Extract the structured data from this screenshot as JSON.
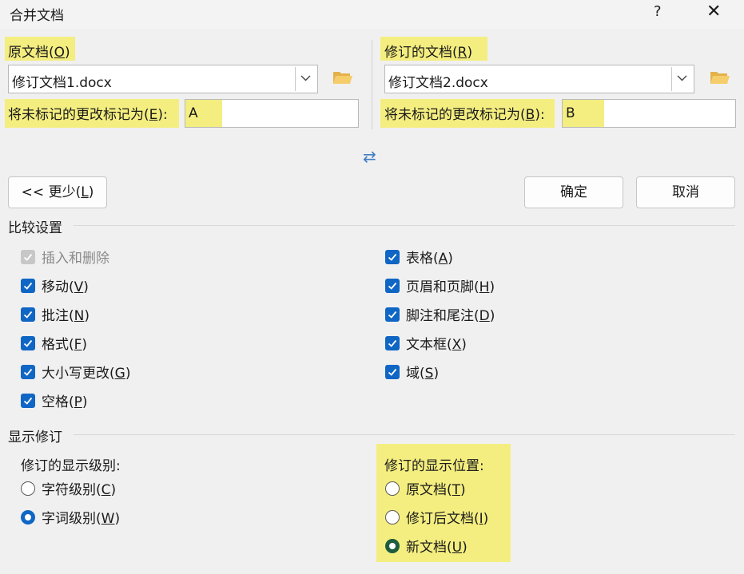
{
  "window": {
    "title": "合并文档",
    "help_glyph": "?",
    "close_glyph": "✕"
  },
  "original": {
    "label_text": "原文档(",
    "label_key": "O",
    "label_end": ")",
    "file": "修订文档1.docx",
    "mark_label_text": "将未标记的更改标记为(",
    "mark_label_key": "E",
    "mark_label_end": "):",
    "mark_value": "A"
  },
  "revised": {
    "label_text": "修订的文档(",
    "label_key": "R",
    "label_end": ")",
    "file": "修订文档2.docx",
    "mark_label_text": "将未标记的更改标记为(",
    "mark_label_key": "B",
    "mark_label_end": "):",
    "mark_value": "B"
  },
  "swap_glyph": "⇄",
  "buttons": {
    "less_text": "<< 更少(",
    "less_key": "L",
    "less_end": ")",
    "ok": "确定",
    "cancel": "取消"
  },
  "compare_settings": {
    "heading": "比较设置",
    "left": [
      {
        "text": "插入和删除",
        "key": "",
        "end": "",
        "checked": true,
        "disabled": true
      },
      {
        "text": "移动(",
        "key": "V",
        "end": ")",
        "checked": true,
        "disabled": false
      },
      {
        "text": "批注(",
        "key": "N",
        "end": ")",
        "checked": true,
        "disabled": false
      },
      {
        "text": "格式(",
        "key": "F",
        "end": ")",
        "checked": true,
        "disabled": false
      },
      {
        "text": "大小写更改(",
        "key": "G",
        "end": ")",
        "checked": true,
        "disabled": false
      },
      {
        "text": "空格(",
        "key": "P",
        "end": ")",
        "checked": true,
        "disabled": false
      }
    ],
    "right": [
      {
        "text": "表格(",
        "key": "A",
        "end": ")",
        "checked": true
      },
      {
        "text": "页眉和页脚(",
        "key": "H",
        "end": ")",
        "checked": true
      },
      {
        "text": "脚注和尾注(",
        "key": "D",
        "end": ")",
        "checked": true
      },
      {
        "text": "文本框(",
        "key": "X",
        "end": ")",
        "checked": true
      },
      {
        "text": "域(",
        "key": "S",
        "end": ")",
        "checked": true
      }
    ]
  },
  "show_changes": {
    "heading": "显示修订",
    "level": {
      "label": "修订的显示级别:",
      "options": [
        {
          "text": "字符级别(",
          "key": "C",
          "end": ")",
          "selected": false
        },
        {
          "text": "字词级别(",
          "key": "W",
          "end": ")",
          "selected": true
        }
      ]
    },
    "location": {
      "label": "修订的显示位置:",
      "options": [
        {
          "text": "原文档(",
          "key": "T",
          "end": ")",
          "selected": false
        },
        {
          "text": "修订后文档(",
          "key": "I",
          "end": ")",
          "selected": false
        },
        {
          "text": "新文档(",
          "key": "U",
          "end": ")",
          "selected": true
        }
      ]
    }
  },
  "colors": {
    "accent": "#0f66c4",
    "highlight": "#f4ee80",
    "selected_dark": "#1d5c3e"
  }
}
